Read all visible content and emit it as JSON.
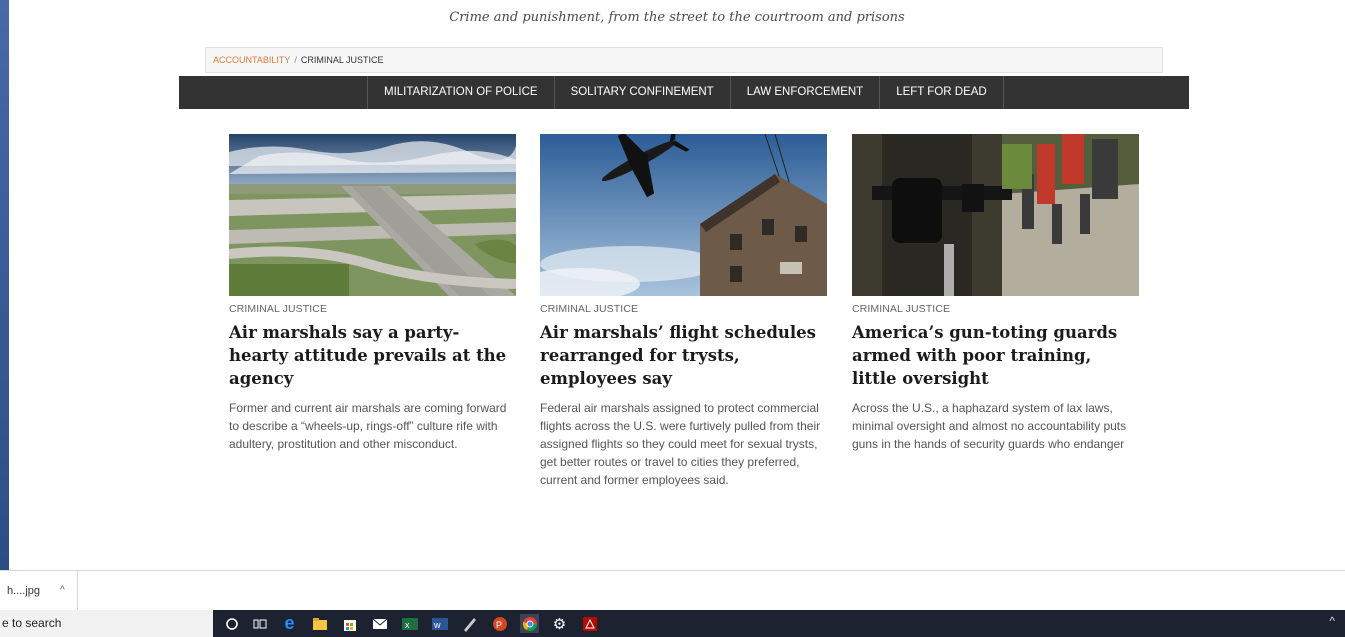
{
  "tagline": "Crime and punishment, from the street to the courtroom and prisons",
  "breadcrumb": {
    "home": "ACCOUNTABILITY",
    "separator": "/",
    "current": "CRIMINAL JUSTICE"
  },
  "nav": {
    "items": [
      {
        "label": "MILITARIZATION OF POLICE"
      },
      {
        "label": "SOLITARY CONFINEMENT"
      },
      {
        "label": "LAW ENFORCEMENT"
      },
      {
        "label": "LEFT FOR DEAD"
      }
    ]
  },
  "articles": [
    {
      "category": "CRIMINAL JUSTICE",
      "headline": "Air marshals say a party-hearty attitude prevails at the agency",
      "summary": "Former and current air marshals are coming forward to describe a “wheels-up, rings-off” culture rife with adultery, prostitution and other misconduct.",
      "image": "airport-runway-photo"
    },
    {
      "category": "CRIMINAL JUSTICE",
      "headline": "Air marshals’ flight schedules rearranged for trysts, employees say",
      "summary": "Federal air marshals assigned to protect commercial flights across the U.S. were furtively pulled from their assigned flights so they could meet for sexual trysts, get better routes or travel to cities they preferred, current and former employees said.",
      "image": "airplane-over-building-photo"
    },
    {
      "category": "CRIMINAL JUSTICE",
      "headline": "America’s gun-toting guards armed with poor training, little oversight",
      "summary": "Across the U.S., a haphazard system of lax laws, minimal oversight and almost no accountability puts guns in the hands of security guards who endanger",
      "image": "security-guard-holster-photo"
    }
  ],
  "downloads": {
    "file_label": "h....jpg",
    "chevron": "^"
  },
  "taskbar": {
    "search_text": "e to search",
    "icons": [
      "cortana-icon",
      "task-view-icon",
      "edge-icon",
      "file-explorer-icon",
      "store-icon",
      "mail-icon",
      "excel-icon",
      "word-icon",
      "snipping-icon",
      "powerpoint-icon",
      "chrome-icon",
      "settings-icon",
      "acrobat-icon"
    ],
    "tray_chevron": "^"
  },
  "colors": {
    "accent": "#e07b39",
    "nav_bg": "#333333",
    "taskbar_bg": "#1c2230"
  }
}
